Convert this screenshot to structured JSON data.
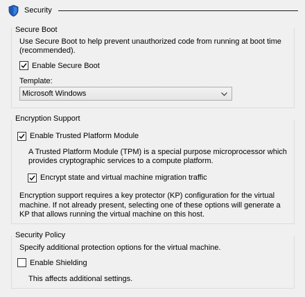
{
  "header": {
    "title": "Security"
  },
  "secure_boot": {
    "group_title": "Secure Boot",
    "description_line1": "Use Secure Boot to help prevent unauthorized code from running at boot time",
    "description_line2": "(recommended).",
    "enable_label": "Enable Secure Boot",
    "enable_checked": true,
    "template_label": "Template:",
    "template_selected": "Microsoft Windows"
  },
  "encryption": {
    "group_title": "Encryption Support",
    "tpm_label": "Enable Trusted Platform Module",
    "tpm_checked": true,
    "tpm_desc_line1": "A Trusted Platform Module (TPM) is a special purpose microprocessor which",
    "tpm_desc_line2": "provides cryptographic services to a compute platform.",
    "encrypt_label": "Encrypt state and virtual machine migration traffic",
    "encrypt_checked": true,
    "note_line1": "Encryption support requires a key protector (KP) configuration for the virtual",
    "note_line2": "machine. If not already present, selecting one of these options will generate a",
    "note_line3": "KP that allows running the virtual machine on this host."
  },
  "security_policy": {
    "group_title": "Security Policy",
    "description": "Specify additional protection options for the virtual machine.",
    "shielding_label": "Enable Shielding",
    "shielding_checked": false,
    "shielding_note": "This affects additional settings."
  },
  "colors": {
    "shield_blue": "#1e5bb8",
    "background": "#f0f0f0",
    "group_border": "#dcdcdc"
  }
}
